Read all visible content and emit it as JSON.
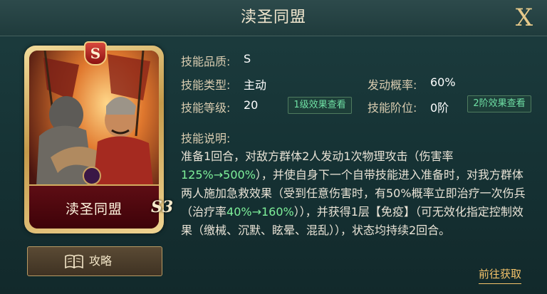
{
  "header": {
    "title": "渎圣同盟",
    "close_label": "X"
  },
  "card": {
    "name": "渎圣同盟",
    "grade_badge": "S",
    "star_mark": "S3",
    "frame_color": "#d8b36a",
    "plate_color": "#5e0d14"
  },
  "guide_button": {
    "label": "攻略",
    "icon": "book-icon"
  },
  "info": {
    "quality_label": "技能品质:",
    "quality_value": "S",
    "type_label": "技能类型:",
    "type_value": "主动",
    "chance_label": "发动概率:",
    "chance_value": "60%",
    "level_label": "技能等级:",
    "level_value": "20",
    "level_effect_btn": "1级效果查看",
    "rank_label": "技能阶位:",
    "rank_value": "0阶",
    "rank_effect_btn": "2阶效果查看"
  },
  "description": {
    "label": "技能说明:",
    "t1": "准备1回合，对敌方群体2人发动1次物理攻击（伤害率",
    "h1": "125%→500%",
    "t2": "），并使自身下一个自带技能进入准备时，对我方群体两人施加急救效果（受到任意伤害时，有50%概率立即治疗一次伤兵（治疗率",
    "h2": "40%→160%",
    "t3": "）），并获得1层【免疫】（可无效化指定控制效果（缴械、沉默、眩晕、混乱）），状态均持续2回合。",
    "highlight_color": "#7ef09a"
  },
  "obtain_link": "前往获取"
}
